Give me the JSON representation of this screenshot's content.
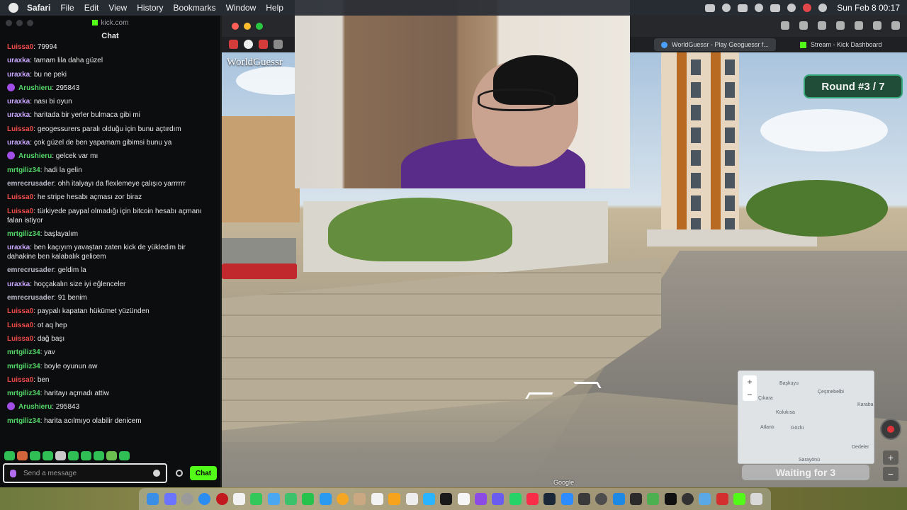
{
  "menubar": {
    "app": "Safari",
    "items": [
      "File",
      "Edit",
      "View",
      "History",
      "Bookmarks",
      "Window",
      "Help"
    ],
    "clock": "Sun Feb 8  00:17"
  },
  "chat_window": {
    "url": "kick.com",
    "title": "Chat",
    "input_placeholder": "Send a message",
    "send_label": "Chat",
    "messages": [
      {
        "user": "Luissa0",
        "color": "#ef4b4b",
        "text": "79994",
        "badge": false
      },
      {
        "user": "uraxka",
        "color": "#c9a6ff",
        "text": "tamam lila daha güzel",
        "badge": false
      },
      {
        "user": "uraxka",
        "color": "#c9a6ff",
        "text": "bu ne peki",
        "badge": false
      },
      {
        "user": "Arushieru",
        "color": "#53d769",
        "text": "295843",
        "badge": true
      },
      {
        "user": "uraxka",
        "color": "#c9a6ff",
        "text": "nası bi oyun",
        "badge": false
      },
      {
        "user": "uraxka",
        "color": "#c9a6ff",
        "text": "haritada bir yerler bulmaca gibi mi",
        "badge": false
      },
      {
        "user": "Luissa0",
        "color": "#ef4b4b",
        "text": "geogessurers paralı olduğu için bunu açtırdım",
        "badge": false
      },
      {
        "user": "uraxka",
        "color": "#c9a6ff",
        "text": "çok güzel de ben yapamam gibimsi bunu ya",
        "badge": false
      },
      {
        "user": "Arushieru",
        "color": "#53d769",
        "text": "gelcek var mı",
        "badge": true
      },
      {
        "user": "mrtgiliz34",
        "color": "#53d769",
        "text": "hadi la gelin",
        "badge": false
      },
      {
        "user": "emrecrusader",
        "color": "#b9b9c8",
        "text": "ohh italyayı da flexlemeye çalışıo yarrrrrr",
        "badge": false
      },
      {
        "user": "Luissa0",
        "color": "#ef4b4b",
        "text": "he stripe hesabı açması zor biraz",
        "badge": false
      },
      {
        "user": "Luissa0",
        "color": "#ef4b4b",
        "text": "türkiyede paypal olmadığı için bitcoin hesabı açmanı falan istiyor",
        "badge": false
      },
      {
        "user": "mrtgiliz34",
        "color": "#53d769",
        "text": "başlayalım",
        "badge": false
      },
      {
        "user": "uraxka",
        "color": "#c9a6ff",
        "text": "ben kaçıyım yavaştan zaten kick de yükledim bir dahakine ben kalabalık gelicem",
        "badge": false
      },
      {
        "user": "emrecrusader",
        "color": "#b9b9c8",
        "text": "geldim la",
        "badge": false
      },
      {
        "user": "uraxka",
        "color": "#c9a6ff",
        "text": "hoççakalın size iyi eğlenceler",
        "badge": false
      },
      {
        "user": "emrecrusader",
        "color": "#b9b9c8",
        "text": "91 benim",
        "badge": false
      },
      {
        "user": "Luissa0",
        "color": "#ef4b4b",
        "text": "paypalı kapatan hükümet yüzünden",
        "badge": false
      },
      {
        "user": "Luissa0",
        "color": "#ef4b4b",
        "text": "ot aq hep",
        "badge": false
      },
      {
        "user": "Luissa0",
        "color": "#ef4b4b",
        "text": "dağ başı",
        "badge": false
      },
      {
        "user": "mrtgiliz34",
        "color": "#53d769",
        "text": "yav",
        "badge": false
      },
      {
        "user": "mrtgiliz34",
        "color": "#53d769",
        "text": "boyle oyunun aw",
        "badge": false
      },
      {
        "user": "Luissa0",
        "color": "#ef4b4b",
        "text": "ben",
        "badge": false
      },
      {
        "user": "mrtgiliz34",
        "color": "#53d769",
        "text": "haritayı açmadı attiw",
        "badge": false
      },
      {
        "user": "Arushieru",
        "color": "#53d769",
        "text": "295843",
        "badge": true
      },
      {
        "user": "mrtgiliz34",
        "color": "#53d769",
        "text": "harita acılmıyo olabilir denicem",
        "badge": false
      }
    ]
  },
  "browser": {
    "tabs": [
      {
        "label": "WorldGuessr - Play Geoguessr f...",
        "active": true
      },
      {
        "label": "Stream - Kick Dashboard",
        "active": false
      }
    ]
  },
  "game": {
    "logo": "WorldGuessr",
    "round": "Round #3 / 7",
    "waiting": "Waiting for 3",
    "attribution": "Google",
    "map_labels": [
      "Başkuyu",
      "Çeşmebelbi",
      "Çıkara",
      "Karaba",
      "Kolukısa",
      "Atlantı",
      "Gözlü",
      "Dedeler",
      "Sarayönü"
    ],
    "zoom_in": "+",
    "zoom_out": "−"
  },
  "colors": {
    "kick_green": "#53fc18",
    "round_badge_bg": "#1f4d38"
  }
}
